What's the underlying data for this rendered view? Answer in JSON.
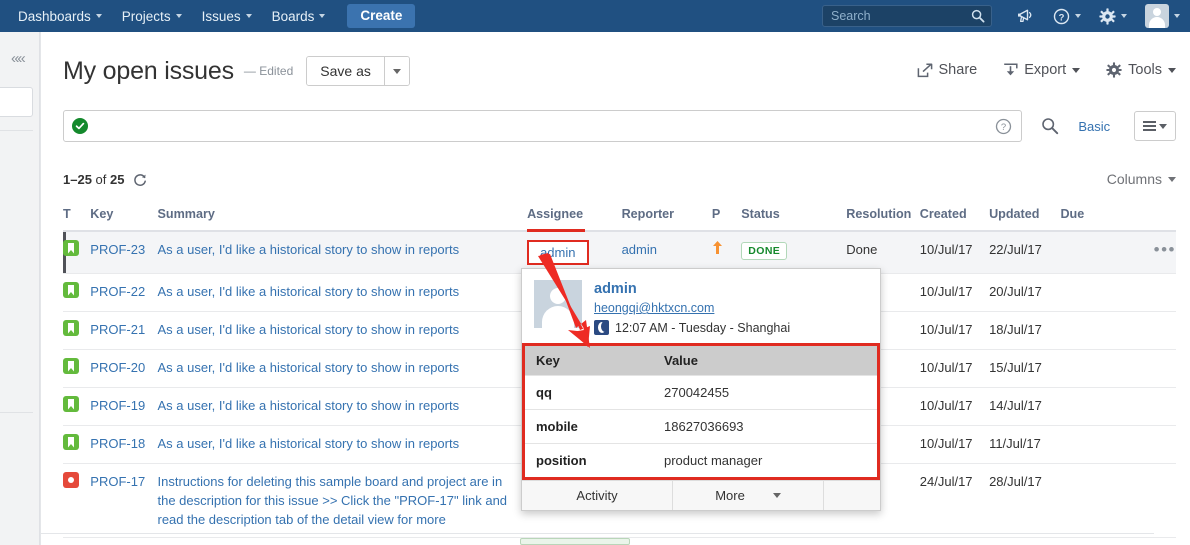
{
  "topnav": {
    "items": [
      {
        "label": "Dashboards",
        "has_caret": true
      },
      {
        "label": "Projects",
        "has_caret": true
      },
      {
        "label": "Issues",
        "has_caret": true
      },
      {
        "label": "Boards",
        "has_caret": true
      }
    ],
    "create_label": "Create",
    "search_placeholder": "Search",
    "icons": [
      "search-icon",
      "announcement-icon",
      "help-icon",
      "settings-gear-icon",
      "user-avatar-icon"
    ]
  },
  "sidebar": {
    "collapse_icon": "««"
  },
  "header": {
    "title": "My open issues",
    "edited_label": "— Edited",
    "save_as_label": "Save as",
    "share_label": "Share",
    "export_label": "Export",
    "tools_label": "Tools"
  },
  "filter": {
    "jql_value": "",
    "jql_placeholder": "",
    "status_icon": "valid-check-icon",
    "help_icon": "question-circle-icon",
    "search_icon": "search-icon",
    "basic_label": "Basic",
    "view_mode_icon": "list-view-icon"
  },
  "results": {
    "count_range": "1–25",
    "count_of": "of",
    "count_total": "25",
    "refresh_icon": "refresh-icon",
    "columns_label": "Columns"
  },
  "table": {
    "headers": [
      "T",
      "Key",
      "Summary",
      "Assignee",
      "Reporter",
      "P",
      "Status",
      "Resolution",
      "Created",
      "Updated",
      "Due"
    ],
    "rows": [
      {
        "type": "story",
        "key": "PROF-23",
        "summary": "As a user, I'd like a historical story to show in reports",
        "assignee": "admin",
        "reporter": "admin",
        "priority": "major-up-arrow",
        "status": "DONE",
        "resolution": "Done",
        "created": "10/Jul/17",
        "updated": "22/Jul/17",
        "due": "",
        "selected": true,
        "assignee_highlighted": true,
        "actions": "•••"
      },
      {
        "type": "story",
        "key": "PROF-22",
        "summary": "As a user, I'd like a historical story to show in reports",
        "assignee": "",
        "reporter": "",
        "priority": "",
        "status": "",
        "resolution": "",
        "created": "10/Jul/17",
        "updated": "20/Jul/17",
        "due": "",
        "selected": false,
        "assignee_highlighted": false,
        "actions": ""
      },
      {
        "type": "story",
        "key": "PROF-21",
        "summary": "As a user, I'd like a historical story to show in reports",
        "assignee": "",
        "reporter": "",
        "priority": "",
        "status": "",
        "resolution": "",
        "created": "10/Jul/17",
        "updated": "18/Jul/17",
        "due": "",
        "selected": false,
        "assignee_highlighted": false,
        "actions": ""
      },
      {
        "type": "story",
        "key": "PROF-20",
        "summary": "As a user, I'd like a historical story to show in reports",
        "assignee": "",
        "reporter": "",
        "priority": "",
        "status": "",
        "resolution": "",
        "created": "10/Jul/17",
        "updated": "15/Jul/17",
        "due": "",
        "selected": false,
        "assignee_highlighted": false,
        "actions": ""
      },
      {
        "type": "story",
        "key": "PROF-19",
        "summary": "As a user, I'd like a historical story to show in reports",
        "assignee": "",
        "reporter": "",
        "priority": "",
        "status": "",
        "resolution": "",
        "created": "10/Jul/17",
        "updated": "14/Jul/17",
        "due": "",
        "selected": false,
        "assignee_highlighted": false,
        "actions": ""
      },
      {
        "type": "story",
        "key": "PROF-18",
        "summary": "As a user, I'd like a historical story to show in reports",
        "assignee": "",
        "reporter": "",
        "priority": "",
        "status": "",
        "resolution": "",
        "created": "10/Jul/17",
        "updated": "11/Jul/17",
        "due": "",
        "selected": false,
        "assignee_highlighted": false,
        "actions": ""
      },
      {
        "type": "bug",
        "key": "PROF-17",
        "summary": "Instructions for deleting this sample board and project are in the description for this issue >> Click the \"PROF-17\" link and read the description tab of the detail view for more",
        "assignee": "",
        "reporter": "",
        "priority": "",
        "status": "",
        "resolution": "",
        "created": "24/Jul/17",
        "updated": "28/Jul/17",
        "due": "",
        "selected": false,
        "assignee_highlighted": false,
        "actions": ""
      }
    ]
  },
  "profile_popup": {
    "name": "admin",
    "email": "heongqi@hktxcn.com",
    "local_time": "12:07 AM - Tuesday - Shanghai",
    "time_icon": "moon-icon",
    "kv_headers": [
      "Key",
      "Value"
    ],
    "kv_rows": [
      {
        "key": "qq",
        "value": "270042455"
      },
      {
        "key": "mobile",
        "value": "18627036693"
      },
      {
        "key": "position",
        "value": "product manager"
      }
    ],
    "footer": {
      "activity_label": "Activity",
      "more_label": "More"
    }
  },
  "colors": {
    "nav_blue": "#205081",
    "link_blue": "#3572b0",
    "annotation_red": "#e02b20",
    "story_green": "#63ba3c",
    "bug_red": "#e5493a",
    "status_done_green": "#14892c",
    "priority_orange": "#f79232"
  }
}
